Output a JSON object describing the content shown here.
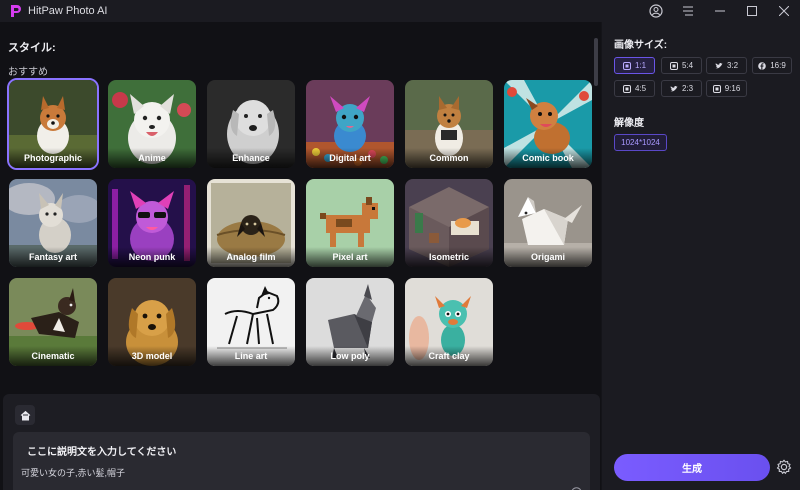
{
  "app": {
    "title": "HitPaw Photo AI"
  },
  "left": {
    "style_title": "スタイル:",
    "recommended_title": "おすすめ",
    "styles": [
      {
        "label": "Photographic",
        "selected": true
      },
      {
        "label": "Anime"
      },
      {
        "label": "Enhance"
      },
      {
        "label": "Digital art"
      },
      {
        "label": "Common"
      },
      {
        "label": "Comic book"
      },
      {
        "label": "Fantasy art"
      },
      {
        "label": "Neon punk"
      },
      {
        "label": "Analog film"
      },
      {
        "label": "Pixel art"
      },
      {
        "label": "Isometric"
      },
      {
        "label": "Origami"
      },
      {
        "label": "Cinematic"
      },
      {
        "label": "3D model"
      },
      {
        "label": "Line art"
      },
      {
        "label": "Low poly"
      },
      {
        "label": "Craft clay"
      }
    ]
  },
  "prompt": {
    "label": "ここに説明文を入力してください",
    "value": "可愛い女の子,赤い髪,帽子"
  },
  "right": {
    "size_title": "画像サイズ:",
    "ratios": [
      {
        "label": "1:1",
        "icon": "square-icon",
        "active": true
      },
      {
        "label": "5:4",
        "icon": "square-icon"
      },
      {
        "label": "3:2",
        "icon": "twitter-icon"
      },
      {
        "label": "16:9",
        "icon": "facebook-icon"
      },
      {
        "label": "4:5",
        "icon": "square-icon"
      },
      {
        "label": "2:3",
        "icon": "twitter-icon"
      },
      {
        "label": "9:16",
        "icon": "square-icon"
      }
    ],
    "resolution_title": "解像度",
    "resolution_value": "1024*1024",
    "generate_label": "生成"
  },
  "colors": {
    "accent": "#7a5cff",
    "background": "#141419",
    "panel": "#1b1b21"
  }
}
